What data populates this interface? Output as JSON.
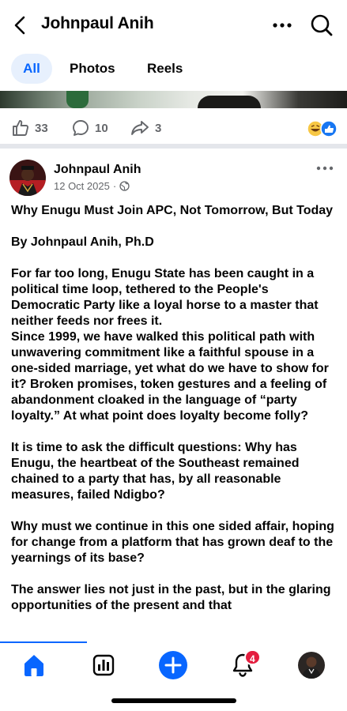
{
  "header": {
    "title": "Johnpaul Anih"
  },
  "tabs": [
    {
      "label": "All"
    },
    {
      "label": "Photos"
    },
    {
      "label": "Reels"
    }
  ],
  "engagement": {
    "likes": "33",
    "comments": "10",
    "shares": "3"
  },
  "post": {
    "author": "Johnpaul Anih",
    "date": "12 Oct 2025",
    "separator": "·",
    "paragraphs": [
      "Why Enugu Must Join APC, Not Tomorrow, But Today",
      "By Johnpaul Anih, Ph.D",
      "For far too long, Enugu State has been caught in a political time loop, tethered to the People's Democratic Party like a loyal horse to a master that neither feeds nor frees it.",
      "Since 1999, we have walked this political path with unwavering commitment like a faithful spouse in a one-sided marriage, yet what do we have to show for it? Broken promises, token gestures and a feeling of abandonment cloaked in the language of “party loyalty.” At what point does loyalty become folly?",
      "It is time to ask the difficult questions: Why has Enugu, the heartbeat of the Southeast remained chained to a party that has, by all reasonable measures, failed Ndigbo?",
      "Why must we continue in this one sided affair, hoping for change from a platform that has grown deaf to the yearnings of its base?",
      "The answer lies not just in the past, but in the glaring opportunities of the present and that"
    ]
  },
  "nav": {
    "notifications_badge": "4"
  },
  "colors": {
    "accent": "#0866ff",
    "badge": "#e41e3f",
    "secondary_text": "#65676b"
  },
  "icons": [
    "back-arrow-icon",
    "more-icon",
    "search-icon",
    "like-icon",
    "comment-icon",
    "share-icon",
    "reactions-icon",
    "globe-icon",
    "home-icon",
    "chart-icon",
    "plus-icon",
    "bell-icon"
  ]
}
